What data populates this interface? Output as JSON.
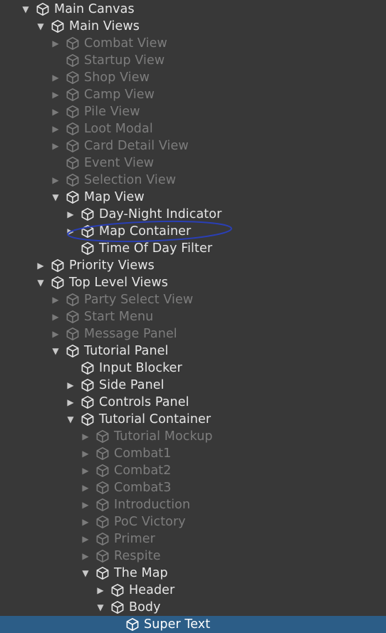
{
  "hierarchy": {
    "rows": [
      {
        "label": "Main Canvas",
        "depth": 0,
        "expand": "open",
        "active": true
      },
      {
        "label": "Main Views",
        "depth": 1,
        "expand": "open",
        "active": true
      },
      {
        "label": "Combat View",
        "depth": 2,
        "expand": "closed",
        "active": false
      },
      {
        "label": "Startup View",
        "depth": 2,
        "expand": "none",
        "active": false
      },
      {
        "label": "Shop View",
        "depth": 2,
        "expand": "closed",
        "active": false
      },
      {
        "label": "Camp View",
        "depth": 2,
        "expand": "closed",
        "active": false
      },
      {
        "label": "Pile View",
        "depth": 2,
        "expand": "closed",
        "active": false
      },
      {
        "label": "Loot Modal",
        "depth": 2,
        "expand": "closed",
        "active": false
      },
      {
        "label": "Card Detail View",
        "depth": 2,
        "expand": "closed",
        "active": false
      },
      {
        "label": "Event View",
        "depth": 2,
        "expand": "none",
        "active": false
      },
      {
        "label": "Selection View",
        "depth": 2,
        "expand": "closed",
        "active": false
      },
      {
        "label": "Map View",
        "depth": 2,
        "expand": "open",
        "active": true
      },
      {
        "label": "Day-Night Indicator",
        "depth": 3,
        "expand": "closed",
        "active": true
      },
      {
        "label": "Map Container",
        "depth": 3,
        "expand": "closed",
        "active": true,
        "circled": true
      },
      {
        "label": "Time Of Day Filter",
        "depth": 3,
        "expand": "none",
        "active": true
      },
      {
        "label": "Priority Views",
        "depth": 1,
        "expand": "closed",
        "active": true
      },
      {
        "label": "Top Level Views",
        "depth": 1,
        "expand": "open",
        "active": true
      },
      {
        "label": "Party Select View",
        "depth": 2,
        "expand": "closed",
        "active": false
      },
      {
        "label": "Start Menu",
        "depth": 2,
        "expand": "closed",
        "active": false
      },
      {
        "label": "Message Panel",
        "depth": 2,
        "expand": "closed",
        "active": false
      },
      {
        "label": "Tutorial Panel",
        "depth": 2,
        "expand": "open",
        "active": true
      },
      {
        "label": "Input Blocker",
        "depth": 3,
        "expand": "none",
        "active": true
      },
      {
        "label": "Side Panel",
        "depth": 3,
        "expand": "closed",
        "active": true
      },
      {
        "label": "Controls Panel",
        "depth": 3,
        "expand": "closed",
        "active": true
      },
      {
        "label": "Tutorial Container",
        "depth": 3,
        "expand": "open",
        "active": true
      },
      {
        "label": "Tutorial Mockup",
        "depth": 4,
        "expand": "closed",
        "active": false
      },
      {
        "label": "Combat1",
        "depth": 4,
        "expand": "closed",
        "active": false
      },
      {
        "label": "Combat2",
        "depth": 4,
        "expand": "closed",
        "active": false
      },
      {
        "label": "Combat3",
        "depth": 4,
        "expand": "closed",
        "active": false
      },
      {
        "label": "Introduction",
        "depth": 4,
        "expand": "closed",
        "active": false
      },
      {
        "label": "PoC Victory",
        "depth": 4,
        "expand": "closed",
        "active": false
      },
      {
        "label": "Primer",
        "depth": 4,
        "expand": "closed",
        "active": false
      },
      {
        "label": "Respite",
        "depth": 4,
        "expand": "closed",
        "active": false
      },
      {
        "label": "The Map",
        "depth": 4,
        "expand": "open",
        "active": true
      },
      {
        "label": "Header",
        "depth": 5,
        "expand": "closed",
        "active": true
      },
      {
        "label": "Body",
        "depth": 5,
        "expand": "open",
        "active": true
      },
      {
        "label": "Super Text",
        "depth": 6,
        "expand": "none",
        "active": true,
        "selected": true
      }
    ]
  },
  "icons": {
    "node_icon": "gameobject-cube-icon",
    "expanded": "triangle-down-icon",
    "collapsed": "triangle-right-icon"
  },
  "colors": {
    "background": "#383838",
    "text_active": "#e6e6e6",
    "text_inactive": "#7d7d7d",
    "selection": "#2c5d87",
    "annotation": "#2a3fb5"
  }
}
